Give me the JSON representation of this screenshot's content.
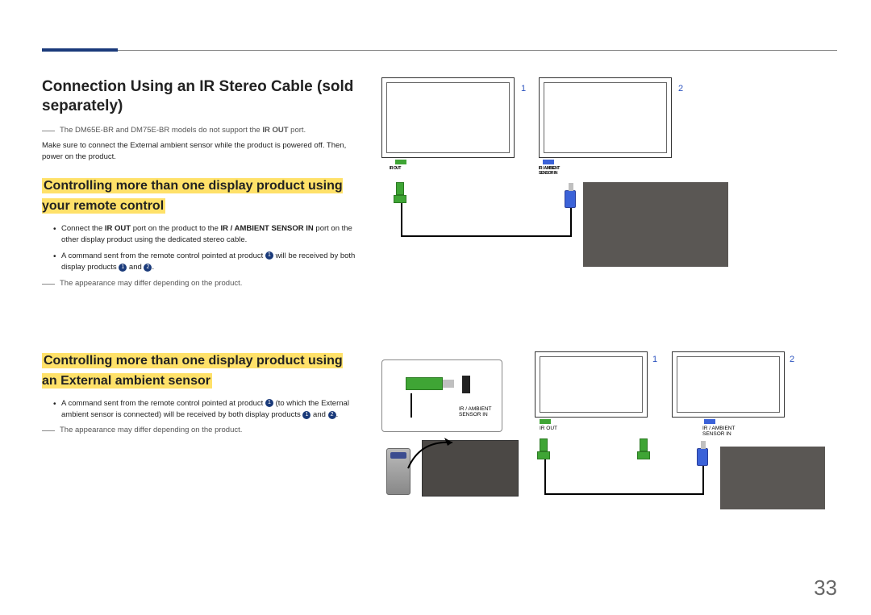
{
  "page_number": "33",
  "title": "Connection Using an IR Stereo Cable (sold separately)",
  "note1_prefix": "The DM65E-BR and DM75E-BR models do not support the ",
  "note1_bold": "IR OUT",
  "note1_suffix": " port.",
  "plain_text": "Make sure to connect the External ambient sensor while the product is powered off. Then, power on the product.",
  "section1_title": "Controlling more than one display product using your remote control",
  "s1_b1_a": "Connect the ",
  "s1_b1_b": "IR OUT",
  "s1_b1_c": " port on the product to the ",
  "s1_b1_d": "IR / AMBIENT SENSOR IN",
  "s1_b1_e": " port on the other display product using the dedicated stereo cable.",
  "s1_b2_a": "A command sent from the remote control pointed at product ",
  "s1_b2_b": " will be received by both display products ",
  "s1_b2_and": " and ",
  "s1_b2_end": ".",
  "appearance_note": "The appearance may differ depending on the product.",
  "section2_title": "Controlling more than one display product using an External ambient sensor",
  "s2_b1_a": "A command sent from the remote control pointed at product ",
  "s2_b1_b": " (to which the External ambient sensor is connected) will be received by both display products ",
  "s2_b1_and": " and ",
  "s2_b1_end": ".",
  "num_1": "1",
  "num_2": "2",
  "diagram1": {
    "label_irout": "IR OUT",
    "label_sensorin": "IR / AMBIENT SENSOR IN"
  },
  "diagram2": {
    "sensor_in": "IR / AMBIENT\nSENSOR IN",
    "ir_out": "IR OUT",
    "sensor_in2": "IR / AMBIENT\nSENSOR IN"
  },
  "circle_1": "1",
  "circle_2": "2"
}
